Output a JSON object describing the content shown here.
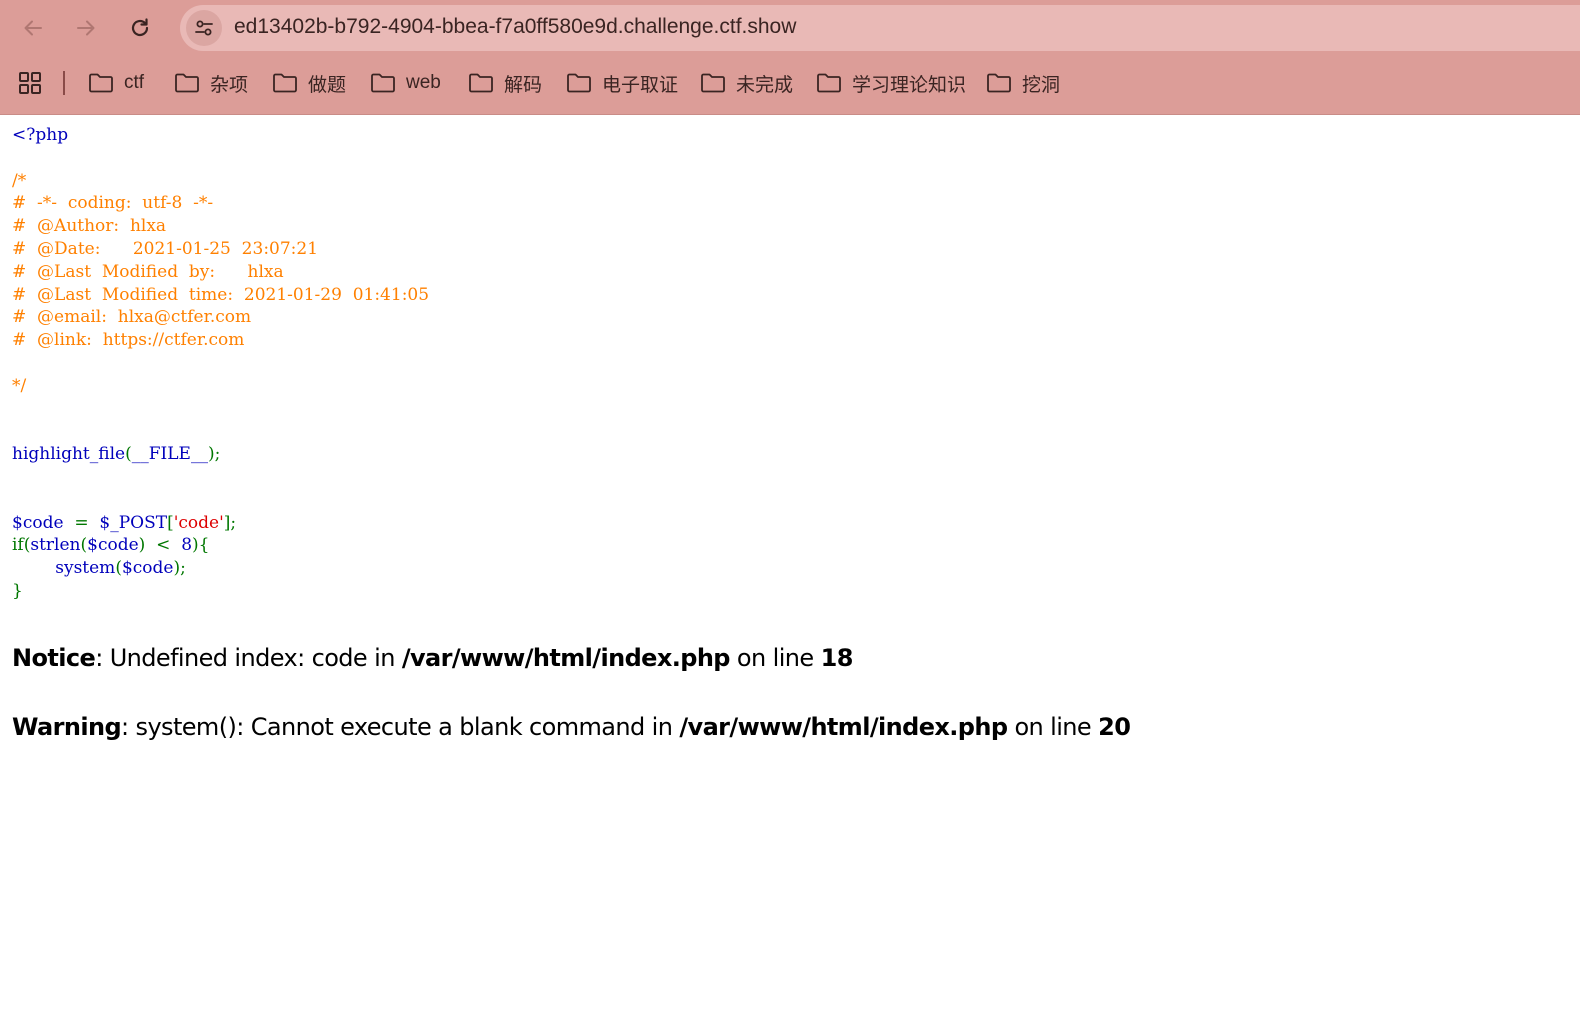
{
  "browser": {
    "url": "ed13402b-b792-4904-bbea-f7a0ff580e9d.challenge.ctf.show",
    "bookmarks": [
      {
        "label": "ctf"
      },
      {
        "label": "杂项"
      },
      {
        "label": "做题"
      },
      {
        "label": "web"
      },
      {
        "label": "解码"
      },
      {
        "label": "电子取证"
      },
      {
        "label": "未完成"
      },
      {
        "label": "学习理论知识"
      },
      {
        "label": "挖洞"
      }
    ],
    "colors": {
      "toolbar": "#dc9d98",
      "address_bar": "#e9b9b6"
    }
  },
  "source": {
    "open_tag": "<?php",
    "comment_lines": [
      "/*",
      "#  -*-  coding:  utf-8  -*-",
      "#  @Author:  hlxa",
      "#  @Date:      2021-01-25  23:07:21",
      "#  @Last  Modified  by:      hlxa",
      "#  @Last  Modified  time:  2021-01-29  01:41:05",
      "#  @email:  hlxa@ctfer.com",
      "#  @link:  https://ctfer.com",
      "",
      "*/"
    ],
    "highlight_fn": "highlight_file",
    "highlight_open": "(",
    "highlight_arg": "__FILE__",
    "highlight_close": ");",
    "code_var": "$code",
    "assign": "=",
    "post_var": "$_POST",
    "bracket_open": "[",
    "post_key": "'code'",
    "bracket_close": "];",
    "if_kw": "if(",
    "strlen_fn": "strlen",
    "strlen_open": "(",
    "strlen_arg": "$code",
    "strlen_close": ")",
    "lt": "<",
    "limit": "8",
    "if_close": "){",
    "system_fn": "system",
    "system_open": "(",
    "system_arg": "$code",
    "system_close": ");",
    "block_close": "}",
    "colors": {
      "default": "#0000BB",
      "comment": "#FF8000",
      "keyword": "#007700",
      "string": "#DD0000"
    }
  },
  "errors": [
    {
      "level": "Notice",
      "message": ": Undefined index: code in ",
      "file": "/var/www/html/index.php",
      "mid": " on line ",
      "line": "18"
    },
    {
      "level": "Warning",
      "message": ": system(): Cannot execute a blank command in ",
      "file": "/var/www/html/index.php",
      "mid": " on line ",
      "line": "20"
    }
  ]
}
